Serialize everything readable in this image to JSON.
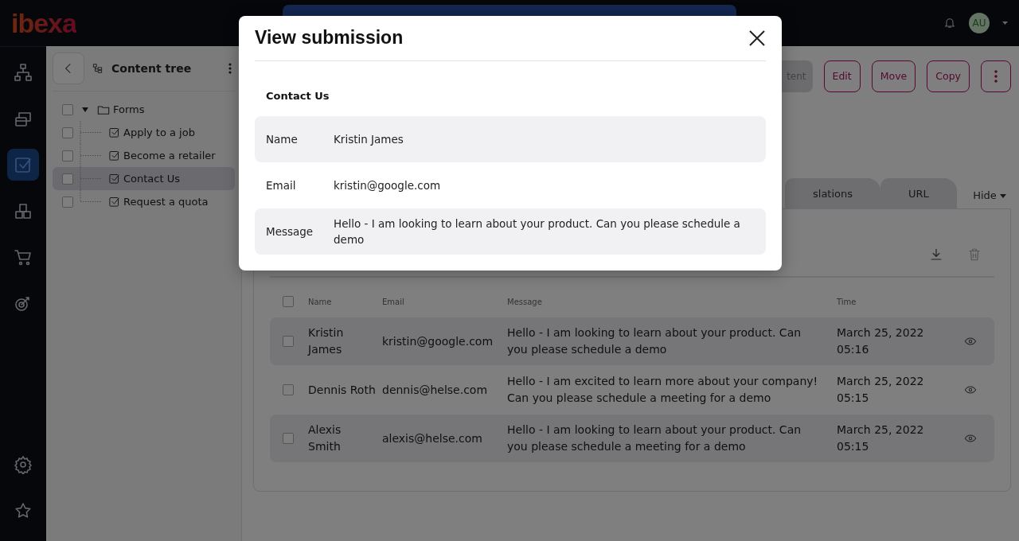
{
  "header": {
    "logo": "ibexa",
    "avatar": "AU"
  },
  "rail": [
    {
      "selected": false
    },
    {
      "selected": false
    },
    {
      "selected": true
    },
    {
      "selected": false
    },
    {
      "selected": false
    },
    {
      "selected": false
    }
  ],
  "rail_bottom": [
    {
      "selected": false
    },
    {
      "selected": false
    }
  ],
  "tree": {
    "title": "Content tree",
    "items": [
      {
        "label": "Forms",
        "expanded": true,
        "selected": false,
        "checked": false,
        "children": [
          {
            "label": "Apply to a job",
            "selected": false,
            "checked": false
          },
          {
            "label": "Become a retailer",
            "selected": false,
            "checked": false
          },
          {
            "label": "Contact Us",
            "selected": true,
            "checked": false
          },
          {
            "label": "Request a quota",
            "selected": false,
            "checked": false
          }
        ]
      }
    ]
  },
  "toolbar": {
    "buttons": [
      {
        "label": "tent",
        "kind": "filled"
      },
      {
        "label": "Edit",
        "kind": "outline"
      },
      {
        "label": "Move",
        "kind": "outline"
      },
      {
        "label": "Copy",
        "kind": "outline"
      },
      {
        "kind": "more"
      }
    ]
  },
  "tabs": [
    {
      "label": "slations",
      "selected": false
    },
    {
      "label": "URL",
      "selected": false
    }
  ],
  "hide": "Hide",
  "table": {
    "select_all": {
      "checked": false
    },
    "columns": [
      "Name",
      "Email",
      "Message",
      "Time"
    ],
    "rows": [
      {
        "name": "Kristin James",
        "email": "kristin@google.com",
        "message": "Hello - I am looking to learn about your product. Can you please schedule a demo",
        "time": "March 25, 2022 05:16",
        "checked": false
      },
      {
        "name": "Dennis Roth",
        "email": "dennis@helse.com",
        "message": "Hello - I am excited to learn more about your company! Can you please schedule a meeting for a demo",
        "time": "March 25, 2022 05:15",
        "checked": false
      },
      {
        "name": "Alexis Smith",
        "email": "alexis@helse.com",
        "message": "Hello - I am looking to learn about your product. Can you please schedule a meeting for a demo",
        "time": "March 25, 2022 05:15",
        "checked": false
      }
    ]
  },
  "modal": {
    "title": "View submission",
    "form": "Contact Us",
    "fields": [
      {
        "label": "Name",
        "value": "Kristin James"
      },
      {
        "label": "Email",
        "value": "kristin@google.com"
      },
      {
        "label": "Message",
        "value": "Hello - I am looking to learn about your product. Can you please schedule a demo"
      }
    ]
  }
}
